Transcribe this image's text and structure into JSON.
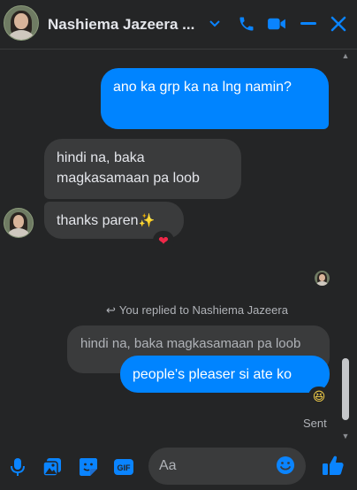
{
  "header": {
    "title": "Nashiema Jazeera ...",
    "icons": [
      "avatar",
      "chevron-down-icon",
      "phone-icon",
      "video-icon",
      "minimize-icon",
      "close-icon"
    ]
  },
  "messages": {
    "out1": "ano ka grp ka na lng namin?",
    "in1": "hindi na, baka magkasamaan pa loob",
    "in2_text": "thanks paren",
    "in2_emoji": "✨",
    "in2_reaction": "❤",
    "reply_note": "You replied to Nashiema Jazeera",
    "quoted": "hindi na, baka magkasamaan pa loob",
    "out2": "people's pleaser si ate ko",
    "out2_reaction": "😆",
    "status": "Sent"
  },
  "composer": {
    "placeholder": "Aa",
    "gif_label": "GIF"
  },
  "colors": {
    "accent": "#0084ff",
    "background": "#242526",
    "bubble_in": "#3a3b3c"
  }
}
